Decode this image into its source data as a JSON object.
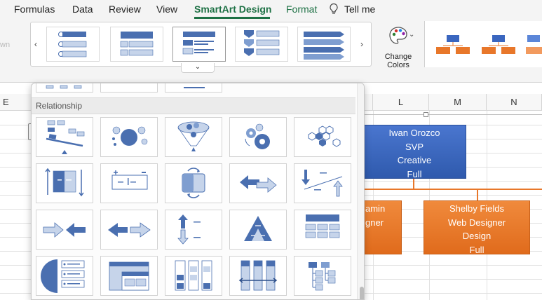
{
  "ribbon_tabs": {
    "formulas": "Formulas",
    "data": "Data",
    "review": "Review",
    "view": "View",
    "smartart_design": "SmartArt Design",
    "format": "Format",
    "tell_me": "Tell me"
  },
  "ribbon": {
    "change_colors_line1": "Change",
    "change_colors_line2": "Colors",
    "faded_text": "wn"
  },
  "columns": {
    "e": "E",
    "l": "L",
    "m": "M",
    "n": "N"
  },
  "gallery_panel": {
    "section_title": "Relationship"
  },
  "org_chart": {
    "top_node": [
      "Iwan Orozco",
      "SVP",
      "Creative",
      "Full"
    ],
    "left_node": [
      "amin",
      "gner"
    ],
    "right_node": [
      "Shelby Fields",
      "Web Designer",
      "Design",
      "Full"
    ]
  },
  "colors": {
    "accent_green": "#1e7145",
    "smartart_blue": "#3a66bf",
    "smartart_orange": "#e8772a",
    "gallery_icon_blue": "#4a6fb0"
  },
  "icons": [
    "chevron-left-icon",
    "chevron-right-icon",
    "chevron-down-icon",
    "lightbulb-icon",
    "palette-icon"
  ]
}
